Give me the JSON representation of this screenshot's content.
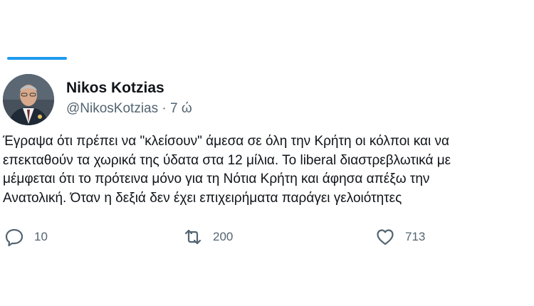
{
  "tweet": {
    "author": {
      "display_name": "Nikos Kotzias",
      "handle": "@NikosKotzias",
      "separator": "·",
      "time": "7 ώ",
      "avatar_icon": "profile-photo-icon"
    },
    "text_lines": [
      "Έγραψα ότι πρέπει να \"κλείσουν\" άμεσα σε όλη την Κρήτη οι κόλποι και να",
      "επεκταθούν τα χωρικά της ύδατα στα 12 μίλια. Το liberal διαστρεβλωτικά με",
      "μέμφεται ότι το πρότεινα μόνο για τη Νότια Κρήτη και άφησα απέξω την",
      "Ανατολική. Όταν η δεξιά δεν έχει επιχειρήματα παράγει γελοιότητες"
    ],
    "actions": {
      "reply": {
        "icon": "reply-icon",
        "count": "10"
      },
      "retweet": {
        "icon": "retweet-icon",
        "count": "200"
      },
      "like": {
        "icon": "heart-icon",
        "count": "713"
      }
    }
  },
  "colors": {
    "accent": "#1d9bf0",
    "text_primary": "#0f1419",
    "text_secondary": "#536471"
  }
}
